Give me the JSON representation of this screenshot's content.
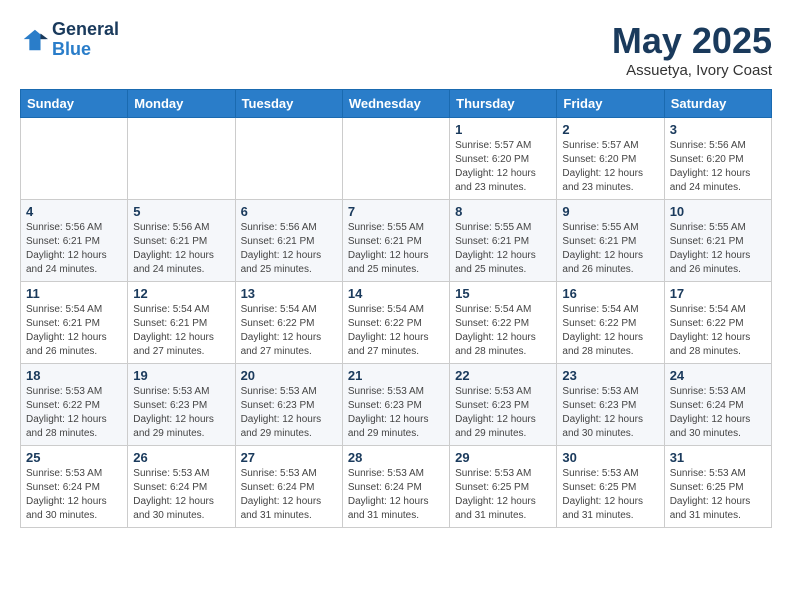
{
  "header": {
    "logo_line1": "General",
    "logo_line2": "Blue",
    "month": "May 2025",
    "location": "Assuetya, Ivory Coast"
  },
  "weekdays": [
    "Sunday",
    "Monday",
    "Tuesday",
    "Wednesday",
    "Thursday",
    "Friday",
    "Saturday"
  ],
  "weeks": [
    [
      {
        "day": "",
        "info": ""
      },
      {
        "day": "",
        "info": ""
      },
      {
        "day": "",
        "info": ""
      },
      {
        "day": "",
        "info": ""
      },
      {
        "day": "1",
        "info": "Sunrise: 5:57 AM\nSunset: 6:20 PM\nDaylight: 12 hours\nand 23 minutes."
      },
      {
        "day": "2",
        "info": "Sunrise: 5:57 AM\nSunset: 6:20 PM\nDaylight: 12 hours\nand 23 minutes."
      },
      {
        "day": "3",
        "info": "Sunrise: 5:56 AM\nSunset: 6:20 PM\nDaylight: 12 hours\nand 24 minutes."
      }
    ],
    [
      {
        "day": "4",
        "info": "Sunrise: 5:56 AM\nSunset: 6:21 PM\nDaylight: 12 hours\nand 24 minutes."
      },
      {
        "day": "5",
        "info": "Sunrise: 5:56 AM\nSunset: 6:21 PM\nDaylight: 12 hours\nand 24 minutes."
      },
      {
        "day": "6",
        "info": "Sunrise: 5:56 AM\nSunset: 6:21 PM\nDaylight: 12 hours\nand 25 minutes."
      },
      {
        "day": "7",
        "info": "Sunrise: 5:55 AM\nSunset: 6:21 PM\nDaylight: 12 hours\nand 25 minutes."
      },
      {
        "day": "8",
        "info": "Sunrise: 5:55 AM\nSunset: 6:21 PM\nDaylight: 12 hours\nand 25 minutes."
      },
      {
        "day": "9",
        "info": "Sunrise: 5:55 AM\nSunset: 6:21 PM\nDaylight: 12 hours\nand 26 minutes."
      },
      {
        "day": "10",
        "info": "Sunrise: 5:55 AM\nSunset: 6:21 PM\nDaylight: 12 hours\nand 26 minutes."
      }
    ],
    [
      {
        "day": "11",
        "info": "Sunrise: 5:54 AM\nSunset: 6:21 PM\nDaylight: 12 hours\nand 26 minutes."
      },
      {
        "day": "12",
        "info": "Sunrise: 5:54 AM\nSunset: 6:21 PM\nDaylight: 12 hours\nand 27 minutes."
      },
      {
        "day": "13",
        "info": "Sunrise: 5:54 AM\nSunset: 6:22 PM\nDaylight: 12 hours\nand 27 minutes."
      },
      {
        "day": "14",
        "info": "Sunrise: 5:54 AM\nSunset: 6:22 PM\nDaylight: 12 hours\nand 27 minutes."
      },
      {
        "day": "15",
        "info": "Sunrise: 5:54 AM\nSunset: 6:22 PM\nDaylight: 12 hours\nand 28 minutes."
      },
      {
        "day": "16",
        "info": "Sunrise: 5:54 AM\nSunset: 6:22 PM\nDaylight: 12 hours\nand 28 minutes."
      },
      {
        "day": "17",
        "info": "Sunrise: 5:54 AM\nSunset: 6:22 PM\nDaylight: 12 hours\nand 28 minutes."
      }
    ],
    [
      {
        "day": "18",
        "info": "Sunrise: 5:53 AM\nSunset: 6:22 PM\nDaylight: 12 hours\nand 28 minutes."
      },
      {
        "day": "19",
        "info": "Sunrise: 5:53 AM\nSunset: 6:23 PM\nDaylight: 12 hours\nand 29 minutes."
      },
      {
        "day": "20",
        "info": "Sunrise: 5:53 AM\nSunset: 6:23 PM\nDaylight: 12 hours\nand 29 minutes."
      },
      {
        "day": "21",
        "info": "Sunrise: 5:53 AM\nSunset: 6:23 PM\nDaylight: 12 hours\nand 29 minutes."
      },
      {
        "day": "22",
        "info": "Sunrise: 5:53 AM\nSunset: 6:23 PM\nDaylight: 12 hours\nand 29 minutes."
      },
      {
        "day": "23",
        "info": "Sunrise: 5:53 AM\nSunset: 6:23 PM\nDaylight: 12 hours\nand 30 minutes."
      },
      {
        "day": "24",
        "info": "Sunrise: 5:53 AM\nSunset: 6:24 PM\nDaylight: 12 hours\nand 30 minutes."
      }
    ],
    [
      {
        "day": "25",
        "info": "Sunrise: 5:53 AM\nSunset: 6:24 PM\nDaylight: 12 hours\nand 30 minutes."
      },
      {
        "day": "26",
        "info": "Sunrise: 5:53 AM\nSunset: 6:24 PM\nDaylight: 12 hours\nand 30 minutes."
      },
      {
        "day": "27",
        "info": "Sunrise: 5:53 AM\nSunset: 6:24 PM\nDaylight: 12 hours\nand 31 minutes."
      },
      {
        "day": "28",
        "info": "Sunrise: 5:53 AM\nSunset: 6:24 PM\nDaylight: 12 hours\nand 31 minutes."
      },
      {
        "day": "29",
        "info": "Sunrise: 5:53 AM\nSunset: 6:25 PM\nDaylight: 12 hours\nand 31 minutes."
      },
      {
        "day": "30",
        "info": "Sunrise: 5:53 AM\nSunset: 6:25 PM\nDaylight: 12 hours\nand 31 minutes."
      },
      {
        "day": "31",
        "info": "Sunrise: 5:53 AM\nSunset: 6:25 PM\nDaylight: 12 hours\nand 31 minutes."
      }
    ]
  ]
}
